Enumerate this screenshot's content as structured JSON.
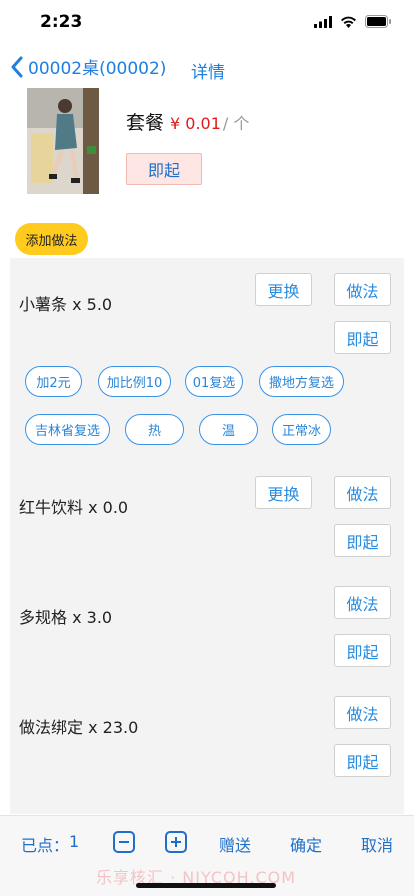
{
  "status": {
    "time": "2:23"
  },
  "nav": {
    "back_label": "00002桌(00002)",
    "detail_label": "详情"
  },
  "combo": {
    "name": "套餐",
    "price": "¥ 0.01",
    "unit": "/ 个",
    "qiqi_label": "即起"
  },
  "add_method_label": "添加做法",
  "items": {
    "fries": {
      "name": "小薯条 x 5.0",
      "replace": "更换",
      "method": "做法",
      "qiqi": "即起",
      "tags": [
        "加2元",
        "加比例10",
        "01复选",
        "撒地方复选",
        "吉林省复选",
        "热",
        "温",
        "正常冰"
      ]
    },
    "redbull": {
      "name": "红牛饮料 x 0.0",
      "replace": "更换",
      "method": "做法",
      "qiqi": "即起"
    },
    "multi": {
      "name": "多规格 x 3.0",
      "method": "做法",
      "qiqi": "即起"
    },
    "bind": {
      "name": "做法绑定 x 23.0",
      "method": "做法",
      "qiqi": "即起"
    }
  },
  "bottom": {
    "ordered_label": "已点：",
    "ordered_count": "1",
    "gift": "赠送",
    "confirm": "确定",
    "cancel": "取消",
    "watermark": "乐享核汇 · NIYCOH.COM"
  },
  "colors": {
    "accent": "#1f7fe0",
    "price": "#e01b1b",
    "add_method_bg": "#ffcb1f",
    "qiqi_bg": "#fde6e3"
  }
}
